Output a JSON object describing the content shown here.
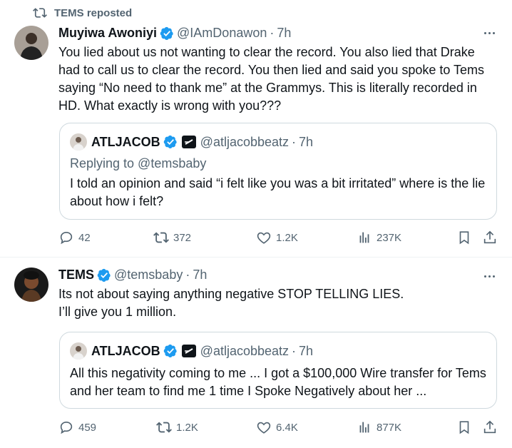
{
  "tweets": [
    {
      "repost_label": "TEMS reposted",
      "author": {
        "name": "Muyiwa Awoniyi",
        "handle": "@IAmDonawon",
        "time": "7h"
      },
      "text": "You lied about us not wanting to clear the record. You also lied that Drake had to call us to clear the record. You then lied and said you spoke to Tems saying “No need to thank me” at the Grammys. This is literally recorded in HD. What exactly  is wrong with you???",
      "quote": {
        "name": "ATLJACOB",
        "handle": "@atljacobbeatz",
        "time": "7h",
        "reply": "Replying to @temsbaby",
        "text": "I told an opinion and said “i felt like you was a bit irritated” where is the lie about how i felt?"
      },
      "stats": {
        "replies": "42",
        "reposts": "372",
        "likes": "1.2K",
        "views": "237K"
      }
    },
    {
      "author": {
        "name": "TEMS",
        "handle": "@temsbaby",
        "time": "7h"
      },
      "text": "Its not about saying anything negative STOP TELLING LIES.\nI’ll give you 1 million.",
      "quote": {
        "name": "ATLJACOB",
        "handle": "@atljacobbeatz",
        "time": "7h",
        "text": "All this negativity coming to me ... I got a $100,000 Wire transfer for Tems and her team to find me 1 time I Spoke Negatively about her ..."
      },
      "stats": {
        "replies": "459",
        "reposts": "1.2K",
        "likes": "6.4K",
        "views": "877K"
      }
    }
  ],
  "colors": {
    "verified": "#1d9bf0",
    "text": "#0f1419",
    "secondary": "#536471",
    "border": "#cfd9de"
  },
  "icons": [
    "repost-icon",
    "verified-badge-icon",
    "more-icon",
    "reply-icon",
    "retweet-icon",
    "like-icon",
    "views-icon",
    "bookmark-icon",
    "share-icon",
    "affiliate-badge-icon"
  ]
}
